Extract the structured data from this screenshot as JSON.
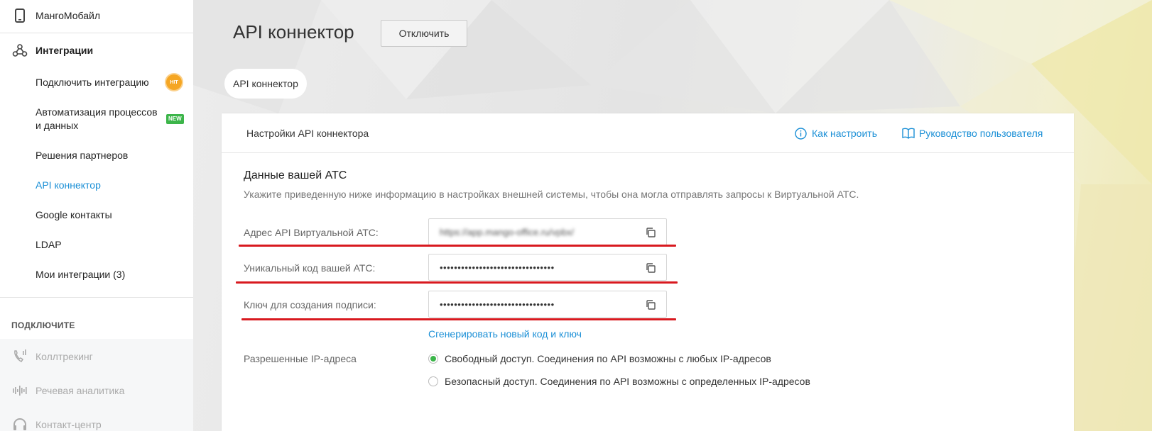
{
  "sidebar": {
    "top_item": {
      "label": "МангоМобайл",
      "icon": "phone-icon"
    },
    "integrations": {
      "label": "Интеграции",
      "icon": "webhook-icon",
      "items": [
        {
          "label": "Подключить интеграцию",
          "badge": "HIT"
        },
        {
          "label_line1": "Автоматизация процессов",
          "label_line2": "и данных",
          "badge": "NEW"
        },
        {
          "label": "Решения партнеров"
        },
        {
          "label": "API коннектор",
          "active": true
        },
        {
          "label": "Google контакты"
        },
        {
          "label": "LDAP"
        },
        {
          "label": "Мои интеграции (3)"
        }
      ]
    },
    "connect_section": {
      "title": "ПОДКЛЮЧИТЕ",
      "items": [
        {
          "label": "Коллтрекинг",
          "icon": "calltracking-icon"
        },
        {
          "label": "Речевая аналитика",
          "icon": "sound-wave-icon"
        },
        {
          "label": "Контакт-центр",
          "icon": "headset-icon"
        }
      ]
    }
  },
  "header": {
    "title": "API коннектор",
    "disconnect_label": "Отключить",
    "tab_label": "API коннектор"
  },
  "card": {
    "title": "Настройки API коннектора",
    "how_to_label": "Как настроить",
    "manual_label": "Руководство пользователя",
    "section_title": "Данные вашей АТС",
    "section_desc": "Укажите приведенную ниже информацию в настройках внешней системы, чтобы она могла отправлять запросы к Виртуальной АТС.",
    "fields": [
      {
        "label": "Адрес API Виртуальной АТС:",
        "value": "https://app.mango-office.ru/vpbx/"
      },
      {
        "label": "Уникальный код вашей АТС:",
        "value": "••••••••••••••••••••••••••••••••"
      },
      {
        "label": "Ключ для создания подписи:",
        "value": "••••••••••••••••••••••••••••••••"
      }
    ],
    "generate_link": "Сгенерировать новый код и ключ",
    "ip_label": "Разрешенные IP-адреса",
    "ip_options": [
      {
        "label": "Свободный доступ. Соединения по API возможны с любых IP-адресов",
        "selected": true
      },
      {
        "label": "Безопасный доступ. Соединения по API возможны с определенных IP-адресов",
        "selected": false
      }
    ]
  },
  "colors": {
    "accent": "#1a8fd6",
    "annotation_red": "#d8191f",
    "radio_green": "#3cb54a",
    "hit_badge": "#f5a623",
    "new_badge": "#3cb54a"
  }
}
